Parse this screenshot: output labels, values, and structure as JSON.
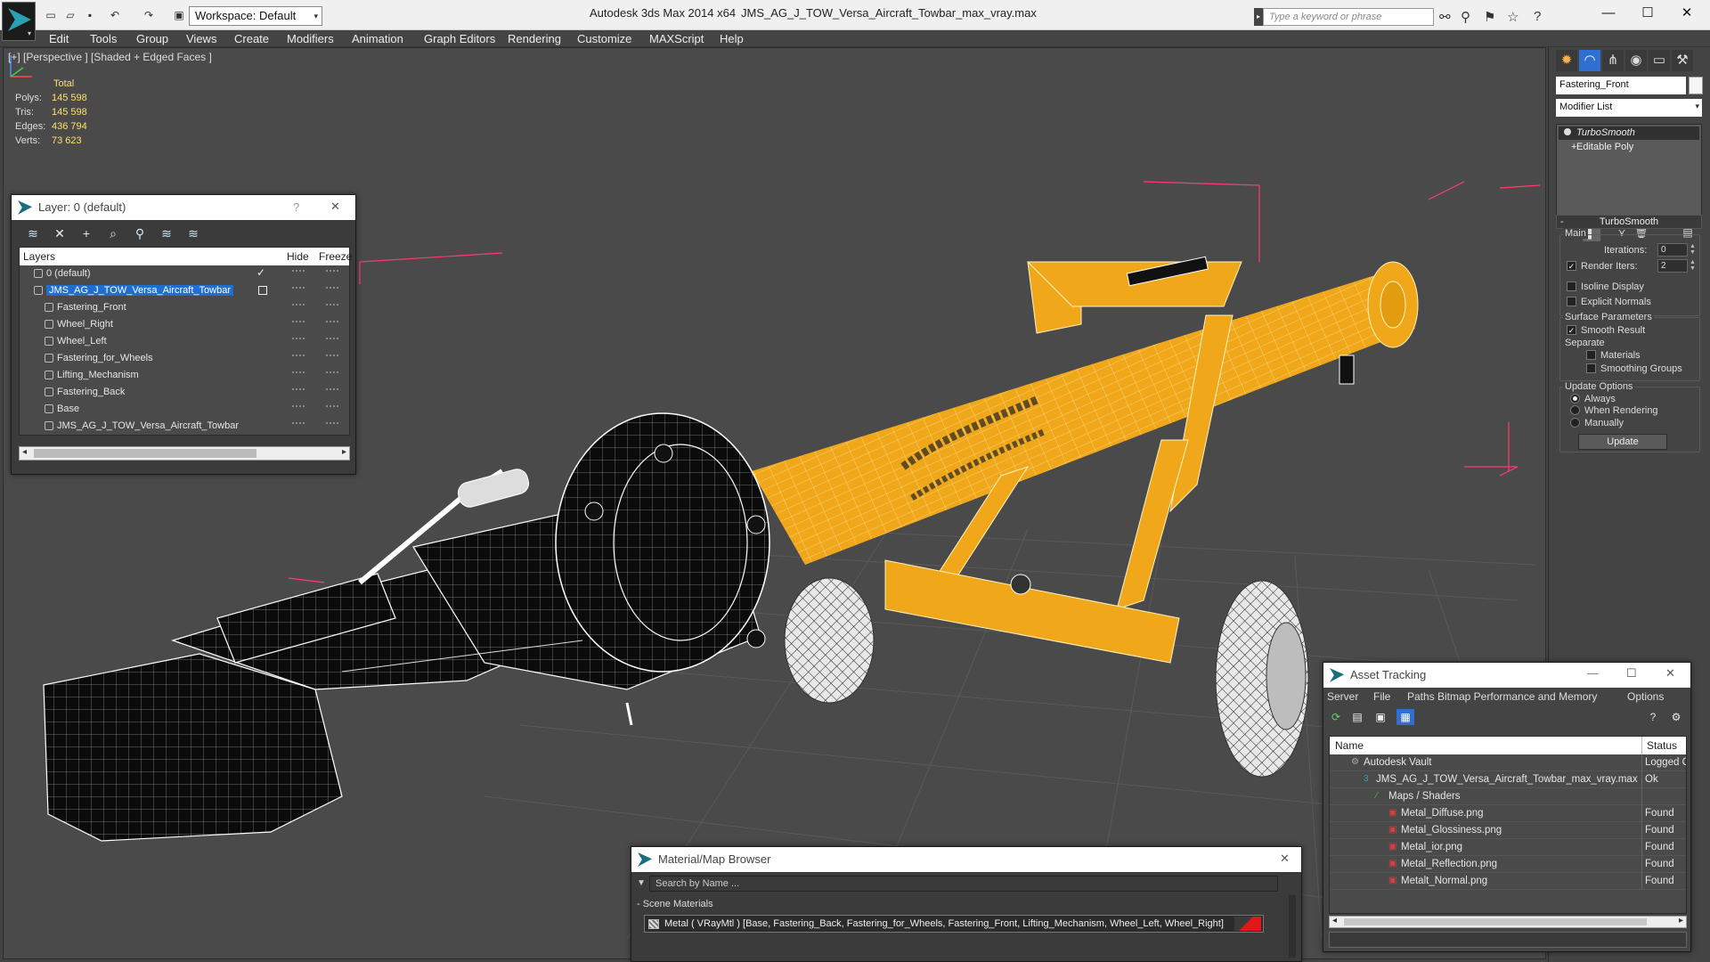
{
  "titlebar": {
    "app_title": "Autodesk 3ds Max  2014 x64",
    "file_title": "JMS_AG_J_TOW_Versa_Aircraft_Towbar_max_vray.max",
    "workspace_label": "Workspace: Default",
    "search_placeholder": "Type a keyword or phrase",
    "window_buttons": [
      "minimize",
      "maximize",
      "close"
    ]
  },
  "menu": [
    "Edit",
    "Tools",
    "Group",
    "Views",
    "Create",
    "Modifiers",
    "Animation",
    "Graph Editors",
    "Rendering",
    "Customize",
    "MAXScript",
    "Help"
  ],
  "viewport": {
    "label": "[+] [Perspective ] [Shaded + Edged Faces ]",
    "stats": {
      "header": "Total",
      "rows": [
        {
          "label": "Polys:",
          "value": "145 598"
        },
        {
          "label": "Tris:",
          "value": "145 598"
        },
        {
          "label": "Edges:",
          "value": "436 794"
        },
        {
          "label": "Verts:",
          "value": "73 623"
        }
      ]
    },
    "colors": {
      "background": "#4a4a4a",
      "model": "#f0a81a",
      "wire": "#ffffff",
      "grid": "#565656",
      "bbox": "#ff3a6e"
    }
  },
  "layer_window": {
    "title": "Layer: 0 (default)",
    "help_label": "?",
    "close_label": "✕",
    "columns": {
      "layers": "Layers",
      "hide": "Hide",
      "freeze": "Freeze"
    },
    "rows": [
      {
        "name": "0 (default)",
        "indent": 0,
        "selected": false,
        "current": true
      },
      {
        "name": "JMS_AG_J_TOW_Versa_Aircraft_Towbar",
        "indent": 0,
        "selected": true,
        "current": false
      },
      {
        "name": "Fastering_Front",
        "indent": 1,
        "selected": false,
        "current": false
      },
      {
        "name": "Wheel_Right",
        "indent": 1,
        "selected": false,
        "current": false
      },
      {
        "name": "Wheel_Left",
        "indent": 1,
        "selected": false,
        "current": false
      },
      {
        "name": "Fastering_for_Wheels",
        "indent": 1,
        "selected": false,
        "current": false
      },
      {
        "name": "Lifting_Mechanism",
        "indent": 1,
        "selected": false,
        "current": false
      },
      {
        "name": "Fastering_Back",
        "indent": 1,
        "selected": false,
        "current": false
      },
      {
        "name": "Base",
        "indent": 1,
        "selected": false,
        "current": false
      },
      {
        "name": "JMS_AG_J_TOW_Versa_Aircraft_Towbar",
        "indent": 1,
        "selected": false,
        "current": false
      }
    ]
  },
  "command_panel": {
    "object_name": "Fastering_Front",
    "modifier_list_label": "Modifier List",
    "stack": [
      {
        "name": "TurboSmooth",
        "selected": true
      },
      {
        "name": "Editable Poly",
        "selected": false
      }
    ],
    "rollout_title": "TurboSmooth",
    "main_group": "Main",
    "iterations_label": "Iterations:",
    "iterations_value": "0",
    "render_iters_label": "Render Iters:",
    "render_iters_value": "2",
    "render_iters_checked": true,
    "isoline_label": "Isoline Display",
    "explicit_normals_label": "Explicit Normals",
    "surface_group": "Surface Parameters",
    "smooth_result_label": "Smooth Result",
    "separate_label": "Separate",
    "materials_label": "Materials",
    "smoothing_groups_label": "Smoothing Groups",
    "update_group": "Update Options",
    "always_label": "Always",
    "when_rendering_label": "When Rendering",
    "manually_label": "Manually",
    "update_button": "Update"
  },
  "material_browser": {
    "title": "Material/Map Browser",
    "close_label": "✕",
    "search_placeholder": "Search by Name ...",
    "group_label": "- Scene Materials",
    "item_label": "Metal  ( VRayMtl ) [Base, Fastering_Back, Fastering_for_Wheels, Fastering_Front, Lifting_Mechanism, Wheel_Left, Wheel_Right]"
  },
  "asset_tracking": {
    "title": "Asset Tracking",
    "menu": [
      "Server",
      "File",
      "Paths",
      "Bitmap Performance and Memory",
      "Options"
    ],
    "columns": {
      "name": "Name",
      "status": "Status"
    },
    "rows": [
      {
        "name": "Autodesk Vault",
        "status": "Logged O",
        "indent": 1,
        "icon": "vault"
      },
      {
        "name": "JMS_AG_J_TOW_Versa_Aircraft_Towbar_max_vray.max",
        "status": "Ok",
        "indent": 2,
        "icon": "max"
      },
      {
        "name": "Maps / Shaders",
        "status": "",
        "indent": 3,
        "icon": "maps"
      },
      {
        "name": "Metal_Diffuse.png",
        "status": "Found",
        "indent": 4,
        "icon": "png"
      },
      {
        "name": "Metal_Glossiness.png",
        "status": "Found",
        "indent": 4,
        "icon": "png"
      },
      {
        "name": "Metal_ior.png",
        "status": "Found",
        "indent": 4,
        "icon": "png"
      },
      {
        "name": "Metal_Reflection.png",
        "status": "Found",
        "indent": 4,
        "icon": "png"
      },
      {
        "name": "Metalt_Normal.png",
        "status": "Found",
        "indent": 4,
        "icon": "png"
      }
    ]
  }
}
